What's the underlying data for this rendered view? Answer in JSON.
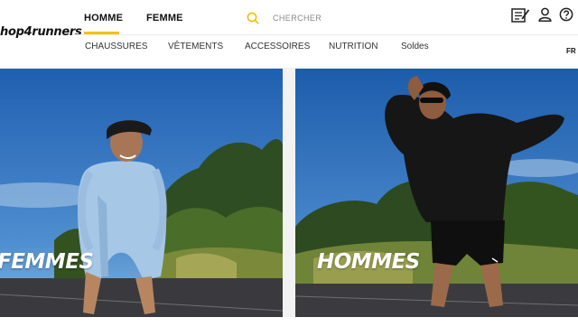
{
  "brand": {
    "logo_text": "hop4runners"
  },
  "header": {
    "gender_tabs": [
      {
        "label": "HOMME",
        "active": true
      },
      {
        "label": "FEMME",
        "active": false
      }
    ],
    "search": {
      "placeholder": "CHERCHER",
      "icon": "search-icon"
    },
    "icons": [
      "notepad-icon",
      "user-icon",
      "help-icon"
    ],
    "language": "FR",
    "accent_color": "#f2c200"
  },
  "nav": {
    "items": [
      "CHAUSSURES",
      "VÊTEMENTS",
      "ACCESSOIRES",
      "NUTRITION",
      "Soldes"
    ]
  },
  "hero": {
    "left_label": "FEMMES",
    "right_label": "HOMMES"
  }
}
